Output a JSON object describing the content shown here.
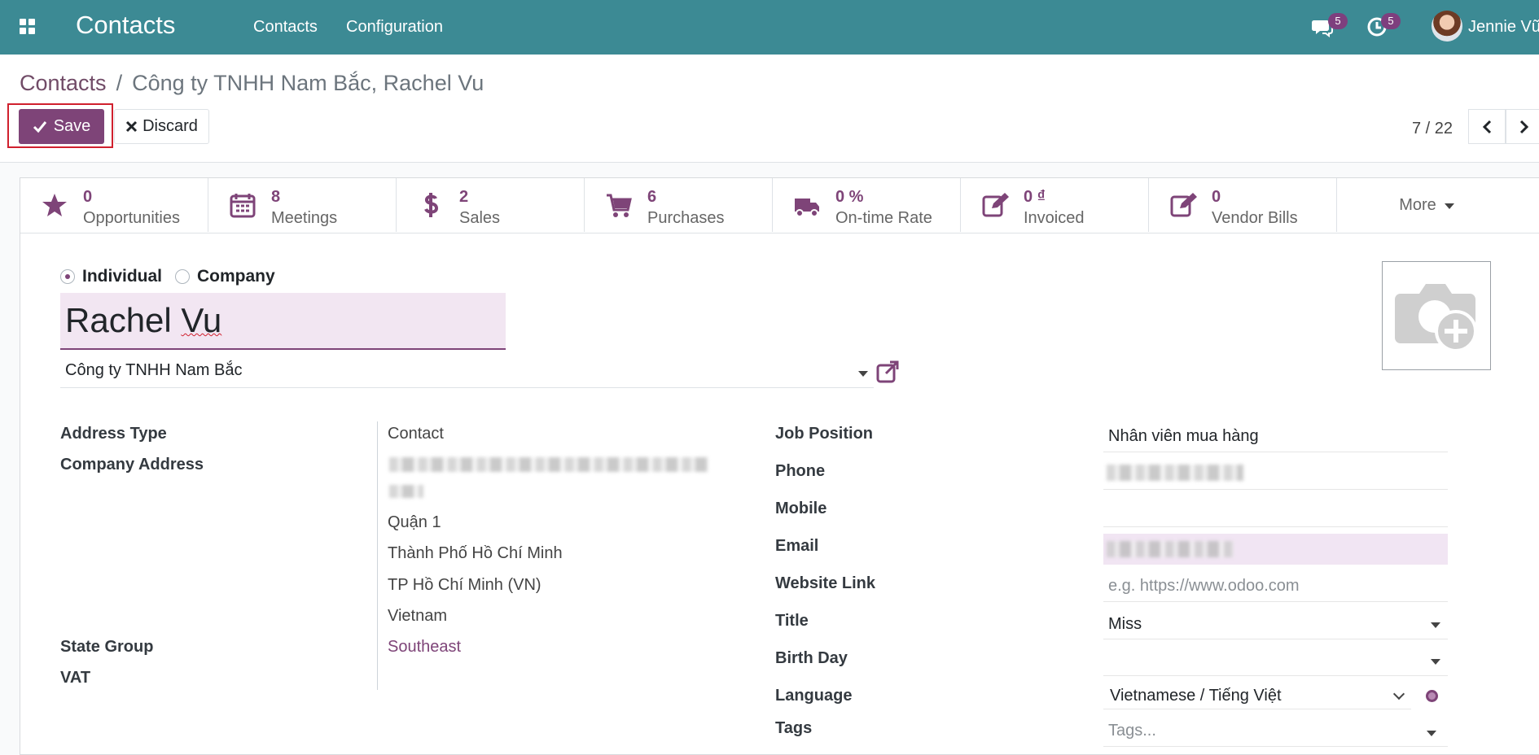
{
  "navbar": {
    "brand": "Contacts",
    "menu_contacts": "Contacts",
    "menu_configuration": "Configuration",
    "messages_count": "5",
    "activities_count": "5",
    "user_name": "Jennie Vũ"
  },
  "breadcrumb": {
    "parent": "Contacts",
    "separator": "/",
    "current": "Công ty TNHH Nam Bắc, Rachel Vu"
  },
  "actions": {
    "save_label": "Save",
    "discard_label": "Discard"
  },
  "pager": {
    "value": "7 / 22"
  },
  "smart_buttons": [
    {
      "value": "0",
      "label": "Opportunities",
      "icon": "star-icon"
    },
    {
      "value": "8",
      "label": "Meetings",
      "icon": "calendar-icon"
    },
    {
      "value": "2",
      "label": "Sales",
      "icon": "dollar-icon"
    },
    {
      "value": "6",
      "label": "Purchases",
      "icon": "cart-icon"
    },
    {
      "value": "0 %",
      "label": "On-time Rate",
      "icon": "truck-icon"
    },
    {
      "value": "0 ₫",
      "label": "Invoiced",
      "icon": "edit-icon"
    },
    {
      "value": "0",
      "label": "Vendor Bills",
      "icon": "edit-icon"
    }
  ],
  "more_label": "More",
  "contact_type": {
    "individual": "Individual",
    "company": "Company",
    "selected": "Individual"
  },
  "partner": {
    "name_first": "Rachel ",
    "name_last": "Vu",
    "company": "Công ty TNHH Nam Bắc"
  },
  "address": {
    "address_type_label": "Address Type",
    "address_type_value": "Contact",
    "company_address_label": "Company Address",
    "district": "Quận 1",
    "city": "Thành Phố Hồ Chí Minh",
    "state": "TP Hồ Chí Minh (VN)",
    "country": "Vietnam",
    "state_group_label": "State Group",
    "state_group_value": "Southeast",
    "vat_label": "VAT"
  },
  "details": {
    "job_position_label": "Job Position",
    "job_position_value": "Nhân viên mua hàng",
    "phone_label": "Phone",
    "mobile_label": "Mobile",
    "email_label": "Email",
    "website_label": "Website Link",
    "website_placeholder": "e.g. https://www.odoo.com",
    "title_label": "Title",
    "title_value": "Miss",
    "birthday_label": "Birth Day",
    "language_label": "Language",
    "language_value": "Vietnamese / Tiếng Việt",
    "tags_label": "Tags",
    "tags_placeholder": "Tags..."
  },
  "colors": {
    "navbar": "#3c8a94",
    "accent": "#7e4478",
    "save_outline": "#d0202e"
  }
}
